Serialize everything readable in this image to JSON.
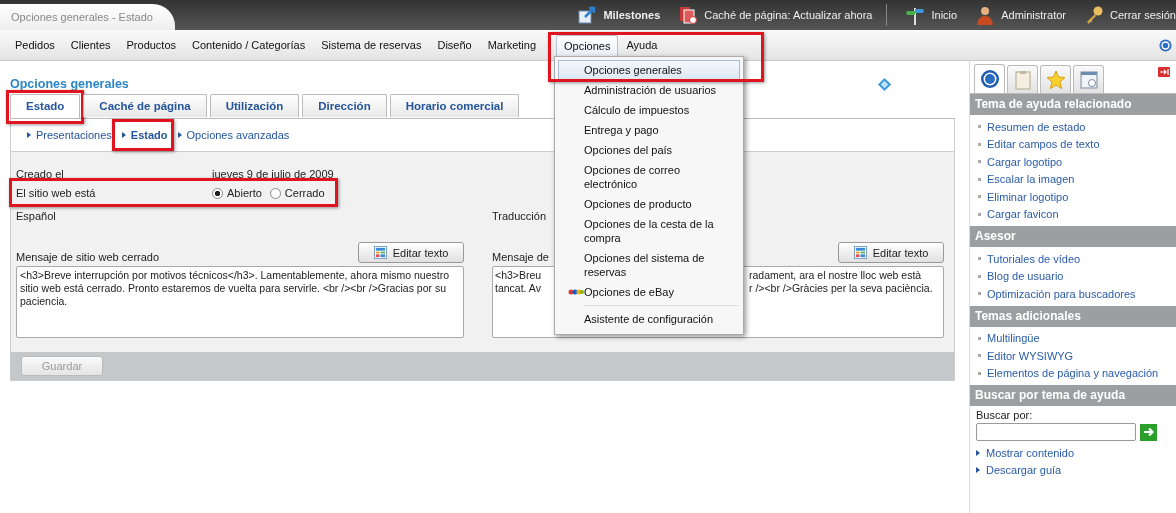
{
  "window": {
    "title": "Opciones generales - Estado"
  },
  "top_links": [
    {
      "kind": "milestones",
      "label": "Milestones"
    },
    {
      "kind": "cache",
      "label": "Caché de página: Actualizar ahora"
    },
    {
      "kind": "home",
      "label": "Inicio"
    },
    {
      "kind": "user",
      "label": "Administrator"
    },
    {
      "kind": "logout",
      "label": "Cerrar sesión"
    }
  ],
  "menu": [
    {
      "label": "Pedidos",
      "selected": false,
      "highlighted": false
    },
    {
      "label": "Clientes",
      "selected": false,
      "highlighted": false
    },
    {
      "label": "Productos",
      "selected": false,
      "highlighted": false
    },
    {
      "label": "Contenido / Categorías",
      "selected": false,
      "highlighted": false
    },
    {
      "label": "Sistema de reservas",
      "selected": false,
      "highlighted": false
    },
    {
      "label": "Diseño",
      "selected": false,
      "highlighted": false
    },
    {
      "label": "Marketing",
      "selected": false,
      "highlighted": false
    },
    {
      "label": "Opciones",
      "selected": true,
      "highlighted": true
    },
    {
      "label": "Ayuda",
      "selected": false,
      "highlighted": false
    }
  ],
  "dropdown": {
    "items": [
      {
        "label": "Opciones generales",
        "selected": true,
        "kind": "plain"
      },
      {
        "label": "Administración de usuarios",
        "selected": false,
        "kind": "plain"
      },
      {
        "label": "Cálculo de impuestos",
        "selected": false,
        "kind": "plain"
      },
      {
        "label": "Entrega y pago",
        "selected": false,
        "kind": "plain"
      },
      {
        "label": "Opciones del país",
        "selected": false,
        "kind": "plain"
      },
      {
        "label": "Opciones de correo electrónico",
        "selected": false,
        "kind": "plain"
      },
      {
        "label": "Opciones de producto",
        "selected": false,
        "kind": "plain"
      },
      {
        "label": "Opciones de la cesta de la compra",
        "selected": false,
        "kind": "plain"
      },
      {
        "label": "Opciones del sistema de reservas",
        "selected": false,
        "kind": "plain"
      },
      {
        "label": "Opciones de eBay",
        "selected": false,
        "kind": "ebay"
      }
    ],
    "footer_item": "Asistente de configuración"
  },
  "page_title": "Opciones generales",
  "tabs": [
    {
      "label": "Estado",
      "selected": true,
      "highlighted": true
    },
    {
      "label": "Caché de página",
      "selected": false,
      "highlighted": false
    },
    {
      "label": "Utilización",
      "selected": false,
      "highlighted": false
    },
    {
      "label": "Dirección",
      "selected": false,
      "highlighted": false
    },
    {
      "label": "Horario comercial",
      "selected": false,
      "highlighted": false
    }
  ],
  "subtabs": [
    {
      "label": "Presentaciones",
      "selected": false,
      "highlighted": false
    },
    {
      "label": "Estado",
      "selected": true,
      "highlighted": true
    },
    {
      "label": "Opciones avanzadas",
      "selected": false,
      "highlighted": false
    }
  ],
  "form": {
    "created_label": "Creado el",
    "created_value": "jueves 9 de julio de 2009",
    "status_label": "El sitio web está",
    "status_highlighted": true,
    "status_options": [
      {
        "label": "Abierto",
        "selected": true
      },
      {
        "label": "Cerrado",
        "selected": false
      }
    ],
    "left": {
      "language": "Español",
      "message_label": "Mensaje de sitio web cerrado",
      "button": "Editar texto",
      "message": "<h3>Breve interrupción por motivos técnicos</h3>. Lamentablemente, ahora mismo nuestro sitio web está cerrado. Pronto estaremos de vuelta para servirle. <br /><br />Gracias por su paciencia."
    },
    "right": {
      "language": "Traducción",
      "message_label": "Mensaje de",
      "button": "Editar texto",
      "message_lines": [
        [
          "<h3>Breu",
          "radament, ara el nostre lloc web està"
        ],
        [
          "tancat. Av",
          "r /><br />Gràcies per la seva paciència."
        ]
      ]
    },
    "save_button": "Guardar"
  },
  "help": {
    "tabs": [
      {
        "kind": "help",
        "selected": true
      },
      {
        "kind": "clipboard",
        "selected": false
      },
      {
        "kind": "star",
        "selected": false
      },
      {
        "kind": "window",
        "selected": false
      }
    ],
    "sections": [
      {
        "title": "Tema de ayuda relacionado",
        "links": [
          "Resumen de estado",
          "Editar campos de texto",
          "Cargar logotipo",
          "Escalar la imagen",
          "Eliminar logotipo",
          "Cargar favicon"
        ]
      },
      {
        "title": "Asesor",
        "links": [
          "Tutoriales de vídeo",
          "Blog de usuario",
          "Optimización para buscadores"
        ]
      },
      {
        "title": "Temas adicionales",
        "links": [
          "Multilingüe",
          "Editor WYSIWYG",
          "Elementos de página y navegación"
        ]
      }
    ],
    "search": {
      "title": "Buscar por tema de ayuda",
      "label": "Buscar por:",
      "links": [
        "Mostrar contenido",
        "Descargar guía"
      ]
    }
  }
}
